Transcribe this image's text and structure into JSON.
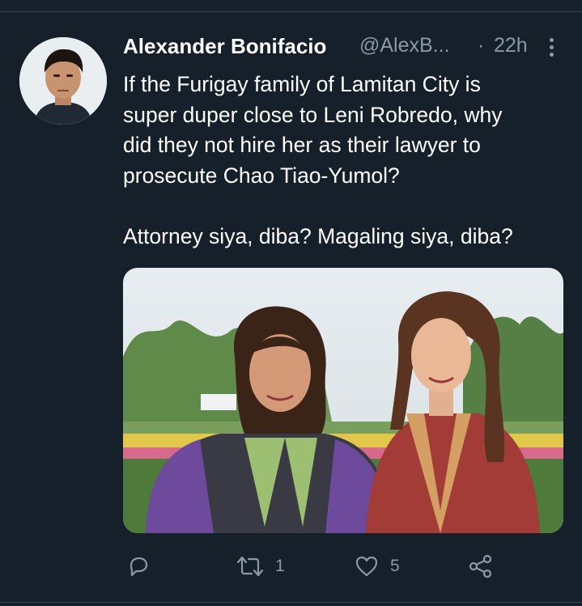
{
  "tweet": {
    "author_name": "Alexander Bonifacio",
    "handle": "@AlexB...",
    "separator": "·",
    "time": "22h",
    "text_lines": [
      "If the Furigay family of Lamitan City is",
      "super duper close to Leni Robredo, why",
      "did they not hire her as their lawyer to",
      "prosecute Chao Tiao-Yumol?"
    ],
    "text_line2": "Attorney siya, diba? Magaling siya, diba?",
    "retweet_count": "1",
    "like_count": "5"
  },
  "colors": {
    "background": "#15202b",
    "divider": "#38444d",
    "secondary_text": "#8b98a5",
    "primary_text": "#ffffff"
  },
  "icons": {
    "reply": "reply-icon",
    "retweet": "retweet-icon",
    "like": "heart-icon",
    "share": "share-icon",
    "more": "more-vertical-icon"
  }
}
